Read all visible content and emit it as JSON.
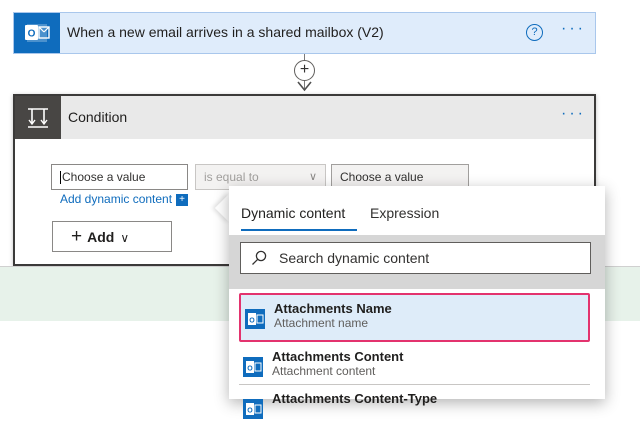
{
  "trigger": {
    "title": "When a new email arrives in a shared mailbox (V2)",
    "help_label": "?",
    "more_label": "···",
    "icon": "outlook-icon"
  },
  "connector": {
    "add_label": "+"
  },
  "condition": {
    "title": "Condition",
    "more_label": "···",
    "icon": "condition-icon",
    "left_operand_placeholder": "Choose a value",
    "operator": "is equal to",
    "right_operand_placeholder": "Choose a value",
    "add_dynamic_label": "Add dynamic content",
    "add_button_label": "Add"
  },
  "flyout": {
    "tabs": [
      {
        "label": "Dynamic content",
        "active": true
      },
      {
        "label": "Expression",
        "active": false
      }
    ],
    "search_placeholder": "Search dynamic content",
    "items": [
      {
        "title": "Attachments Name",
        "subtitle": "Attachment name",
        "highlighted": true,
        "icon": "outlook-icon"
      },
      {
        "title": "Attachments Content",
        "subtitle": "Attachment content",
        "highlighted": false,
        "icon": "outlook-icon"
      },
      {
        "title": "Attachments Content-Type",
        "subtitle": "",
        "highlighted": false,
        "icon": "outlook-icon"
      }
    ]
  },
  "colors": {
    "accent": "#0f6cbd",
    "highlight_border": "#e3336e",
    "trigger_bg": "#dfecfb",
    "green_band": "#e7f2ea"
  }
}
